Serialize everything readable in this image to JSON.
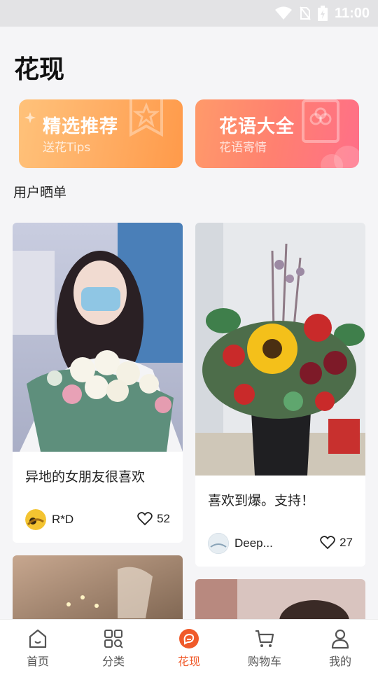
{
  "status_bar": {
    "time": "11:00"
  },
  "page": {
    "title": "花现"
  },
  "banners": [
    {
      "title": "精选推荐",
      "subtitle": "送花Tips"
    },
    {
      "title": "花语大全",
      "subtitle": "花语寄情"
    }
  ],
  "section": {
    "title": "用户晒单"
  },
  "posts": [
    {
      "caption": "异地的女朋友很喜欢",
      "author": "R*D",
      "likes": "52"
    },
    {
      "caption": "喜欢到爆。支持！",
      "author": "Deep...",
      "likes": "27"
    }
  ],
  "tabbar": {
    "items": [
      {
        "label": "首页",
        "icon": "home-icon"
      },
      {
        "label": "分类",
        "icon": "category-icon"
      },
      {
        "label": "花现",
        "icon": "discover-icon"
      },
      {
        "label": "购物车",
        "icon": "cart-icon"
      },
      {
        "label": "我的",
        "icon": "profile-icon"
      }
    ],
    "active_index": 2
  },
  "colors": {
    "accent": "#f05a2a",
    "background": "#f5f5f7"
  }
}
